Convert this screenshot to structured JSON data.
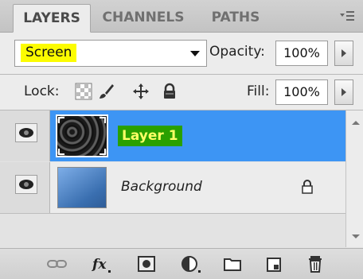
{
  "tabs": [
    {
      "label": "LAYERS"
    },
    {
      "label": "CHANNELS"
    },
    {
      "label": "PATHS"
    }
  ],
  "blend_mode": {
    "value": "Screen"
  },
  "opacity": {
    "label": "Opacity:",
    "value": "100%"
  },
  "lock": {
    "label": "Lock:"
  },
  "fill": {
    "label": "Fill:",
    "value": "100%"
  },
  "layers": [
    {
      "name": "Layer 1",
      "visible": true,
      "selected": true
    },
    {
      "name": "Background",
      "visible": true,
      "locked": true
    }
  ],
  "colors": {
    "selection": "#3d95f4",
    "highlight_yellow": "#fcfc00",
    "label_green": "#2aa000"
  },
  "toolbar_icons": [
    "link-icon",
    "fx-icon",
    "mask-icon",
    "adjustment-icon",
    "folder-icon",
    "new-layer-icon",
    "trash-icon"
  ]
}
